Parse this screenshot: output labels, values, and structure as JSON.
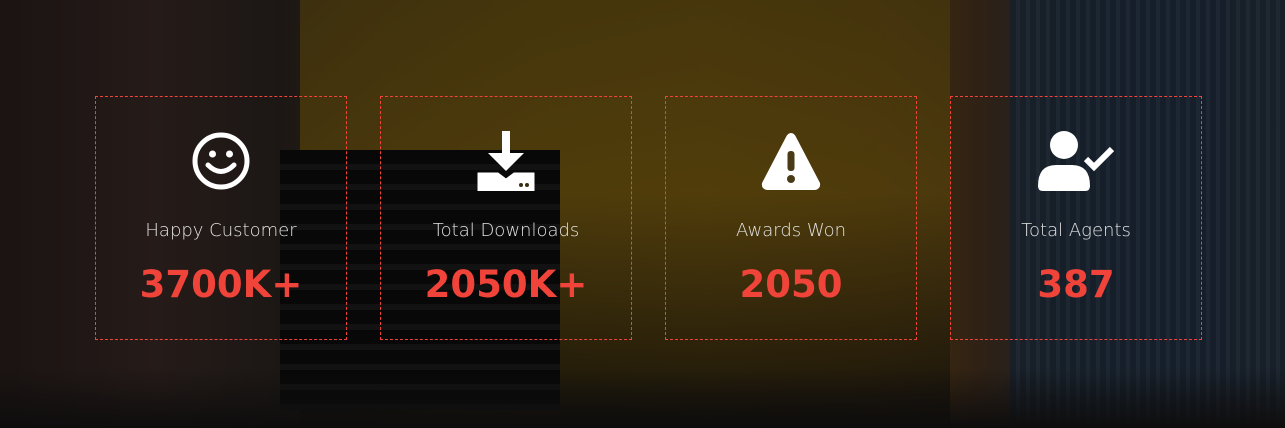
{
  "accent_color": "#f0443a",
  "counters": [
    {
      "icon": "smile-icon",
      "label": "Happy Customer",
      "value": "3700K+"
    },
    {
      "icon": "download-icon",
      "label": "Total Downloads",
      "value": "2050K+"
    },
    {
      "icon": "warning-icon",
      "label": "Awards Won",
      "value": "2050"
    },
    {
      "icon": "user-check-icon",
      "label": "Total Agents",
      "value": "387"
    }
  ]
}
